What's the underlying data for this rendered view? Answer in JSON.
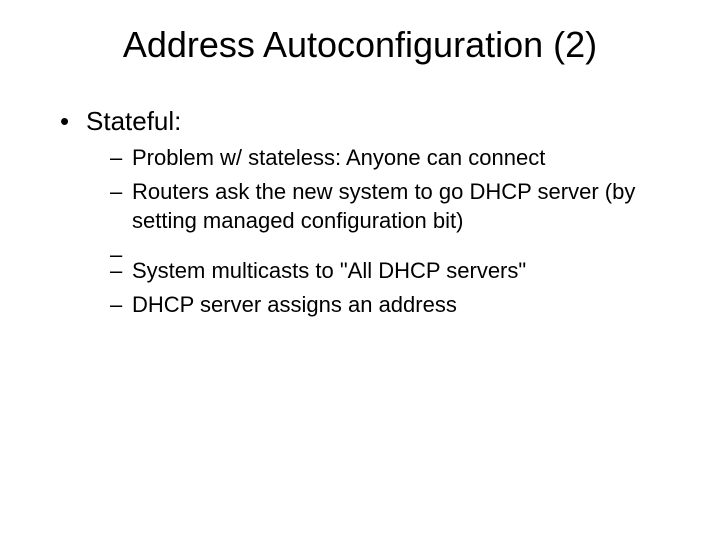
{
  "title": "Address Autoconfiguration (2)",
  "bullets": {
    "l1": "Stateful:",
    "sub": [
      "Problem w/ stateless: Anyone can connect",
      "Routers ask the new system to go DHCP server (by setting managed configuration bit)",
      "System multicasts to \"All DHCP servers\"",
      "DHCP server assigns an address"
    ]
  }
}
